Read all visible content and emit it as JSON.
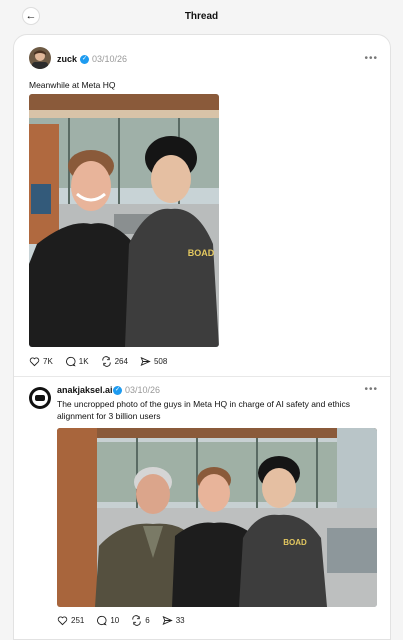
{
  "header": {
    "title": "Thread",
    "back_icon": "arrow-left-icon"
  },
  "posts": [
    {
      "username": "zuck",
      "date": "03/10/26",
      "verified": true,
      "text": "Meanwhile at Meta HQ",
      "hoodie_text": "BOAD",
      "stats": {
        "likes": "7K",
        "replies": "1K",
        "reposts": "264",
        "shares": "508"
      }
    },
    {
      "username": "anakjaksel.ai",
      "date": "03/10/26",
      "verified": true,
      "text": "The uncropped photo of the guys in Meta HQ in charge of AI safety and ethics alignment for 3 billion users",
      "hoodie_text": "BOAD",
      "stats": {
        "likes": "251",
        "replies": "10",
        "reposts": "6",
        "shares": "33"
      }
    }
  ],
  "colors": {
    "verified": "#1d9bf0",
    "background": "#f5f5f5"
  }
}
